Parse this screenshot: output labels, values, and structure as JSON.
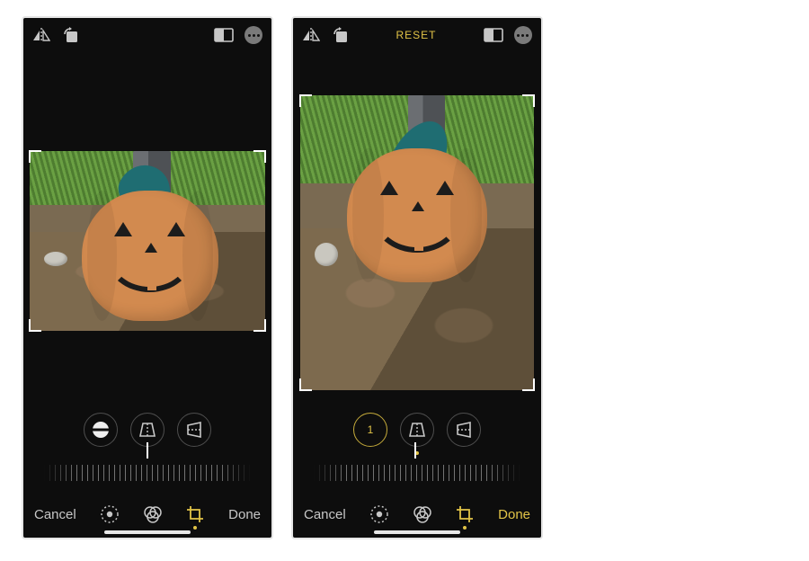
{
  "left": {
    "topbar": {
      "reset_label": ""
    },
    "adjust": {
      "straighten_value": null,
      "straighten_active": false
    },
    "bottombar": {
      "cancel": "Cancel",
      "done": "Done",
      "done_highlight": false
    }
  },
  "right": {
    "topbar": {
      "reset_label": "RESET"
    },
    "adjust": {
      "straighten_value": "1",
      "straighten_active": true
    },
    "bottombar": {
      "cancel": "Cancel",
      "done": "Done",
      "done_highlight": true
    }
  },
  "icons": {
    "flip": "flip-horizontal-icon",
    "rotate": "rotate-icon",
    "aspect": "aspect-ratio-icon",
    "more": "more-icon",
    "straighten": "straighten-icon",
    "vertical": "perspective-vertical-icon",
    "horizontal": "perspective-horizontal-icon",
    "adjust_tool": "adjust-tool-icon",
    "filters_tool": "filters-tool-icon",
    "crop_tool": "crop-tool-icon"
  },
  "accent_color": "#e2c447"
}
